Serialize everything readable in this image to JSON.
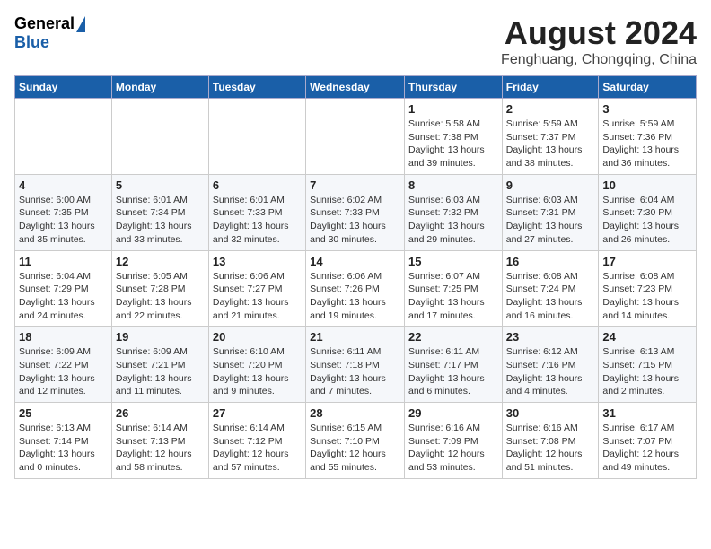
{
  "header": {
    "logo_general": "General",
    "logo_blue": "Blue",
    "title": "August 2024",
    "subtitle": "Fenghuang, Chongqing, China"
  },
  "days_of_week": [
    "Sunday",
    "Monday",
    "Tuesday",
    "Wednesday",
    "Thursday",
    "Friday",
    "Saturday"
  ],
  "weeks": [
    [
      {
        "num": "",
        "info": ""
      },
      {
        "num": "",
        "info": ""
      },
      {
        "num": "",
        "info": ""
      },
      {
        "num": "",
        "info": ""
      },
      {
        "num": "1",
        "info": "Sunrise: 5:58 AM\nSunset: 7:38 PM\nDaylight: 13 hours\nand 39 minutes."
      },
      {
        "num": "2",
        "info": "Sunrise: 5:59 AM\nSunset: 7:37 PM\nDaylight: 13 hours\nand 38 minutes."
      },
      {
        "num": "3",
        "info": "Sunrise: 5:59 AM\nSunset: 7:36 PM\nDaylight: 13 hours\nand 36 minutes."
      }
    ],
    [
      {
        "num": "4",
        "info": "Sunrise: 6:00 AM\nSunset: 7:35 PM\nDaylight: 13 hours\nand 35 minutes."
      },
      {
        "num": "5",
        "info": "Sunrise: 6:01 AM\nSunset: 7:34 PM\nDaylight: 13 hours\nand 33 minutes."
      },
      {
        "num": "6",
        "info": "Sunrise: 6:01 AM\nSunset: 7:33 PM\nDaylight: 13 hours\nand 32 minutes."
      },
      {
        "num": "7",
        "info": "Sunrise: 6:02 AM\nSunset: 7:33 PM\nDaylight: 13 hours\nand 30 minutes."
      },
      {
        "num": "8",
        "info": "Sunrise: 6:03 AM\nSunset: 7:32 PM\nDaylight: 13 hours\nand 29 minutes."
      },
      {
        "num": "9",
        "info": "Sunrise: 6:03 AM\nSunset: 7:31 PM\nDaylight: 13 hours\nand 27 minutes."
      },
      {
        "num": "10",
        "info": "Sunrise: 6:04 AM\nSunset: 7:30 PM\nDaylight: 13 hours\nand 26 minutes."
      }
    ],
    [
      {
        "num": "11",
        "info": "Sunrise: 6:04 AM\nSunset: 7:29 PM\nDaylight: 13 hours\nand 24 minutes."
      },
      {
        "num": "12",
        "info": "Sunrise: 6:05 AM\nSunset: 7:28 PM\nDaylight: 13 hours\nand 22 minutes."
      },
      {
        "num": "13",
        "info": "Sunrise: 6:06 AM\nSunset: 7:27 PM\nDaylight: 13 hours\nand 21 minutes."
      },
      {
        "num": "14",
        "info": "Sunrise: 6:06 AM\nSunset: 7:26 PM\nDaylight: 13 hours\nand 19 minutes."
      },
      {
        "num": "15",
        "info": "Sunrise: 6:07 AM\nSunset: 7:25 PM\nDaylight: 13 hours\nand 17 minutes."
      },
      {
        "num": "16",
        "info": "Sunrise: 6:08 AM\nSunset: 7:24 PM\nDaylight: 13 hours\nand 16 minutes."
      },
      {
        "num": "17",
        "info": "Sunrise: 6:08 AM\nSunset: 7:23 PM\nDaylight: 13 hours\nand 14 minutes."
      }
    ],
    [
      {
        "num": "18",
        "info": "Sunrise: 6:09 AM\nSunset: 7:22 PM\nDaylight: 13 hours\nand 12 minutes."
      },
      {
        "num": "19",
        "info": "Sunrise: 6:09 AM\nSunset: 7:21 PM\nDaylight: 13 hours\nand 11 minutes."
      },
      {
        "num": "20",
        "info": "Sunrise: 6:10 AM\nSunset: 7:20 PM\nDaylight: 13 hours\nand 9 minutes."
      },
      {
        "num": "21",
        "info": "Sunrise: 6:11 AM\nSunset: 7:18 PM\nDaylight: 13 hours\nand 7 minutes."
      },
      {
        "num": "22",
        "info": "Sunrise: 6:11 AM\nSunset: 7:17 PM\nDaylight: 13 hours\nand 6 minutes."
      },
      {
        "num": "23",
        "info": "Sunrise: 6:12 AM\nSunset: 7:16 PM\nDaylight: 13 hours\nand 4 minutes."
      },
      {
        "num": "24",
        "info": "Sunrise: 6:13 AM\nSunset: 7:15 PM\nDaylight: 13 hours\nand 2 minutes."
      }
    ],
    [
      {
        "num": "25",
        "info": "Sunrise: 6:13 AM\nSunset: 7:14 PM\nDaylight: 13 hours\nand 0 minutes."
      },
      {
        "num": "26",
        "info": "Sunrise: 6:14 AM\nSunset: 7:13 PM\nDaylight: 12 hours\nand 58 minutes."
      },
      {
        "num": "27",
        "info": "Sunrise: 6:14 AM\nSunset: 7:12 PM\nDaylight: 12 hours\nand 57 minutes."
      },
      {
        "num": "28",
        "info": "Sunrise: 6:15 AM\nSunset: 7:10 PM\nDaylight: 12 hours\nand 55 minutes."
      },
      {
        "num": "29",
        "info": "Sunrise: 6:16 AM\nSunset: 7:09 PM\nDaylight: 12 hours\nand 53 minutes."
      },
      {
        "num": "30",
        "info": "Sunrise: 6:16 AM\nSunset: 7:08 PM\nDaylight: 12 hours\nand 51 minutes."
      },
      {
        "num": "31",
        "info": "Sunrise: 6:17 AM\nSunset: 7:07 PM\nDaylight: 12 hours\nand 49 minutes."
      }
    ]
  ]
}
